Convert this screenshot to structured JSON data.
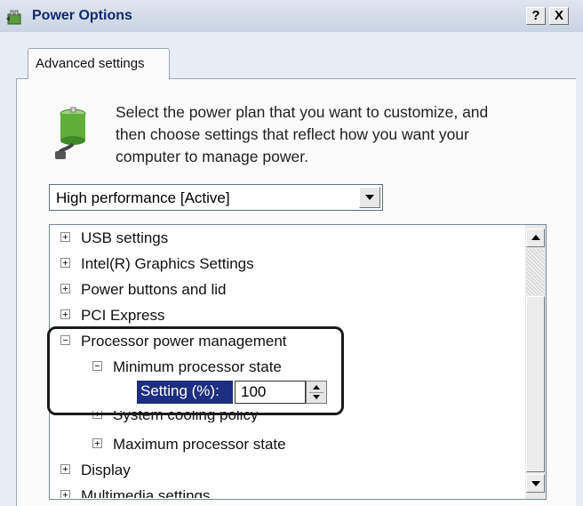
{
  "window": {
    "title": "Power Options",
    "help_label": "?",
    "close_label": "X"
  },
  "tab": {
    "label": "Advanced settings"
  },
  "description": {
    "lines": [
      "Select the power plan that you want to customize, and",
      "then choose settings that reflect how you want your",
      "computer to manage power."
    ]
  },
  "plan_select": {
    "value": "High performance [Active]"
  },
  "tree": {
    "items": [
      {
        "label": "USB settings",
        "expanded": false
      },
      {
        "label": "Intel(R) Graphics Settings",
        "expanded": false
      },
      {
        "label": "Power buttons and lid",
        "expanded": false
      },
      {
        "label": "PCI Express",
        "expanded": false
      },
      {
        "label": "Processor power management",
        "expanded": true
      },
      {
        "label": "Minimum processor state",
        "expanded": true
      },
      {
        "label": "System cooling policy",
        "expanded": false
      },
      {
        "label": "Maximum processor state",
        "expanded": false
      },
      {
        "label": "Display",
        "expanded": false
      },
      {
        "label": "Multimedia settings",
        "expanded": false
      }
    ],
    "setting": {
      "label": "Setting (%):",
      "value": "100"
    }
  },
  "colors": {
    "accent": "#1d2f82",
    "title_text": "#0f2a6b"
  },
  "icons": {
    "app": "power-options-icon",
    "battery": "battery-plug-icon"
  }
}
